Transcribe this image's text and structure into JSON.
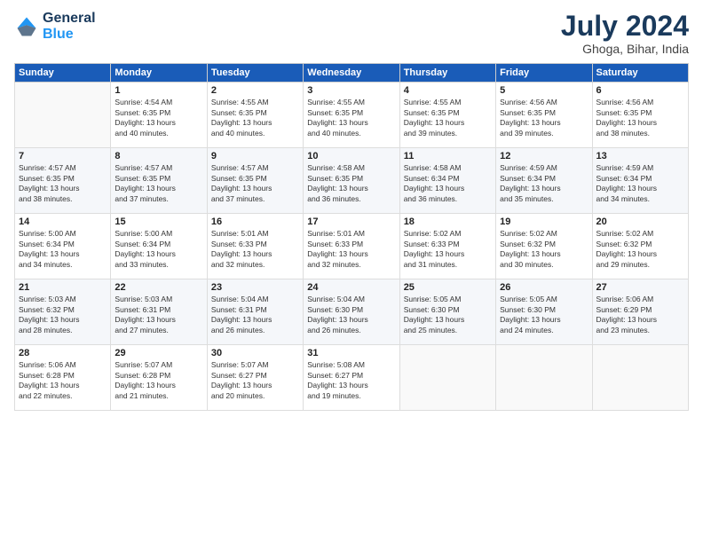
{
  "logo": {
    "line1": "General",
    "line2": "Blue"
  },
  "title": "July 2024",
  "subtitle": "Ghoga, Bihar, India",
  "weekdays": [
    "Sunday",
    "Monday",
    "Tuesday",
    "Wednesday",
    "Thursday",
    "Friday",
    "Saturday"
  ],
  "weeks": [
    [
      {
        "day": "",
        "info": ""
      },
      {
        "day": "1",
        "info": "Sunrise: 4:54 AM\nSunset: 6:35 PM\nDaylight: 13 hours\nand 40 minutes."
      },
      {
        "day": "2",
        "info": "Sunrise: 4:55 AM\nSunset: 6:35 PM\nDaylight: 13 hours\nand 40 minutes."
      },
      {
        "day": "3",
        "info": "Sunrise: 4:55 AM\nSunset: 6:35 PM\nDaylight: 13 hours\nand 40 minutes."
      },
      {
        "day": "4",
        "info": "Sunrise: 4:55 AM\nSunset: 6:35 PM\nDaylight: 13 hours\nand 39 minutes."
      },
      {
        "day": "5",
        "info": "Sunrise: 4:56 AM\nSunset: 6:35 PM\nDaylight: 13 hours\nand 39 minutes."
      },
      {
        "day": "6",
        "info": "Sunrise: 4:56 AM\nSunset: 6:35 PM\nDaylight: 13 hours\nand 38 minutes."
      }
    ],
    [
      {
        "day": "7",
        "info": "Sunrise: 4:57 AM\nSunset: 6:35 PM\nDaylight: 13 hours\nand 38 minutes."
      },
      {
        "day": "8",
        "info": "Sunrise: 4:57 AM\nSunset: 6:35 PM\nDaylight: 13 hours\nand 37 minutes."
      },
      {
        "day": "9",
        "info": "Sunrise: 4:57 AM\nSunset: 6:35 PM\nDaylight: 13 hours\nand 37 minutes."
      },
      {
        "day": "10",
        "info": "Sunrise: 4:58 AM\nSunset: 6:35 PM\nDaylight: 13 hours\nand 36 minutes."
      },
      {
        "day": "11",
        "info": "Sunrise: 4:58 AM\nSunset: 6:34 PM\nDaylight: 13 hours\nand 36 minutes."
      },
      {
        "day": "12",
        "info": "Sunrise: 4:59 AM\nSunset: 6:34 PM\nDaylight: 13 hours\nand 35 minutes."
      },
      {
        "day": "13",
        "info": "Sunrise: 4:59 AM\nSunset: 6:34 PM\nDaylight: 13 hours\nand 34 minutes."
      }
    ],
    [
      {
        "day": "14",
        "info": "Sunrise: 5:00 AM\nSunset: 6:34 PM\nDaylight: 13 hours\nand 34 minutes."
      },
      {
        "day": "15",
        "info": "Sunrise: 5:00 AM\nSunset: 6:34 PM\nDaylight: 13 hours\nand 33 minutes."
      },
      {
        "day": "16",
        "info": "Sunrise: 5:01 AM\nSunset: 6:33 PM\nDaylight: 13 hours\nand 32 minutes."
      },
      {
        "day": "17",
        "info": "Sunrise: 5:01 AM\nSunset: 6:33 PM\nDaylight: 13 hours\nand 32 minutes."
      },
      {
        "day": "18",
        "info": "Sunrise: 5:02 AM\nSunset: 6:33 PM\nDaylight: 13 hours\nand 31 minutes."
      },
      {
        "day": "19",
        "info": "Sunrise: 5:02 AM\nSunset: 6:32 PM\nDaylight: 13 hours\nand 30 minutes."
      },
      {
        "day": "20",
        "info": "Sunrise: 5:02 AM\nSunset: 6:32 PM\nDaylight: 13 hours\nand 29 minutes."
      }
    ],
    [
      {
        "day": "21",
        "info": "Sunrise: 5:03 AM\nSunset: 6:32 PM\nDaylight: 13 hours\nand 28 minutes."
      },
      {
        "day": "22",
        "info": "Sunrise: 5:03 AM\nSunset: 6:31 PM\nDaylight: 13 hours\nand 27 minutes."
      },
      {
        "day": "23",
        "info": "Sunrise: 5:04 AM\nSunset: 6:31 PM\nDaylight: 13 hours\nand 26 minutes."
      },
      {
        "day": "24",
        "info": "Sunrise: 5:04 AM\nSunset: 6:30 PM\nDaylight: 13 hours\nand 26 minutes."
      },
      {
        "day": "25",
        "info": "Sunrise: 5:05 AM\nSunset: 6:30 PM\nDaylight: 13 hours\nand 25 minutes."
      },
      {
        "day": "26",
        "info": "Sunrise: 5:05 AM\nSunset: 6:30 PM\nDaylight: 13 hours\nand 24 minutes."
      },
      {
        "day": "27",
        "info": "Sunrise: 5:06 AM\nSunset: 6:29 PM\nDaylight: 13 hours\nand 23 minutes."
      }
    ],
    [
      {
        "day": "28",
        "info": "Sunrise: 5:06 AM\nSunset: 6:28 PM\nDaylight: 13 hours\nand 22 minutes."
      },
      {
        "day": "29",
        "info": "Sunrise: 5:07 AM\nSunset: 6:28 PM\nDaylight: 13 hours\nand 21 minutes."
      },
      {
        "day": "30",
        "info": "Sunrise: 5:07 AM\nSunset: 6:27 PM\nDaylight: 13 hours\nand 20 minutes."
      },
      {
        "day": "31",
        "info": "Sunrise: 5:08 AM\nSunset: 6:27 PM\nDaylight: 13 hours\nand 19 minutes."
      },
      {
        "day": "",
        "info": ""
      },
      {
        "day": "",
        "info": ""
      },
      {
        "day": "",
        "info": ""
      }
    ]
  ]
}
